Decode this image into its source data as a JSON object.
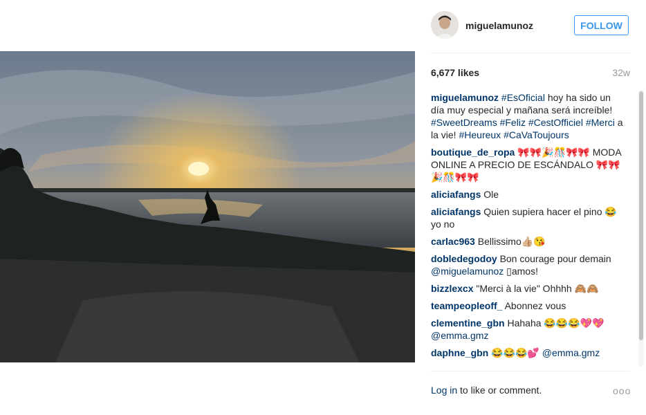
{
  "post": {
    "username": "miguelamunoz",
    "follow_label": "FOLLOW",
    "likes": "6,677 likes",
    "age": "32w"
  },
  "caption": {
    "user": "miguelamunoz",
    "tag1": "#EsOficial",
    "text1": " hoy ha sido un día muy especial y mañana será increíble! ",
    "tag2": "#SweetDreams",
    "tag3": "#Feliz",
    "tag4": "#CestOfficiel",
    "tag5": "#Merci",
    "text2": " a la vie! ",
    "tag6": "#Heureux",
    "tag7": "#CaVaToujours"
  },
  "comments": [
    {
      "user": "boutique_de_ropa",
      "text": "🎀🎀🎉🎊🎀🎀 MODA ONLINE A PRECIO DE ESCÁNDALO 🎀🎀🎉🎊🎀🎀"
    },
    {
      "user": "aliciafangs",
      "text": "Ole"
    },
    {
      "user": "aliciafangs",
      "text": "Quien supiera hacer el pino 😂 yo no"
    },
    {
      "user": "carlac963",
      "text": "Bellissimo👍🏼😘"
    },
    {
      "user": "dobledegodoy",
      "text": "Bon courage pour demain ",
      "mention": "@miguelamunoz",
      "text2": " ▯amos!"
    },
    {
      "user": "bizzlexcx",
      "text": "\"Merci à la vie\" Ohhhh 🙈🙈"
    },
    {
      "user": "teampeopleoff_",
      "text": "Abonnez vous"
    },
    {
      "user": "clementine_gbn",
      "text": "Hahaha 😂😂😂💖💖 ",
      "mention": "@emma.gmz"
    },
    {
      "user": "daphne_gbn",
      "text": "😂😂😂💕 ",
      "mention": "@emma.gmz"
    }
  ],
  "footer": {
    "login_link": "Log in",
    "login_text": " to like or comment.",
    "more": "ooo"
  },
  "icons": {
    "more": "more-options-icon",
    "avatar": "profile-avatar"
  },
  "colors": {
    "accent": "#3897f0",
    "username": "#003569"
  }
}
